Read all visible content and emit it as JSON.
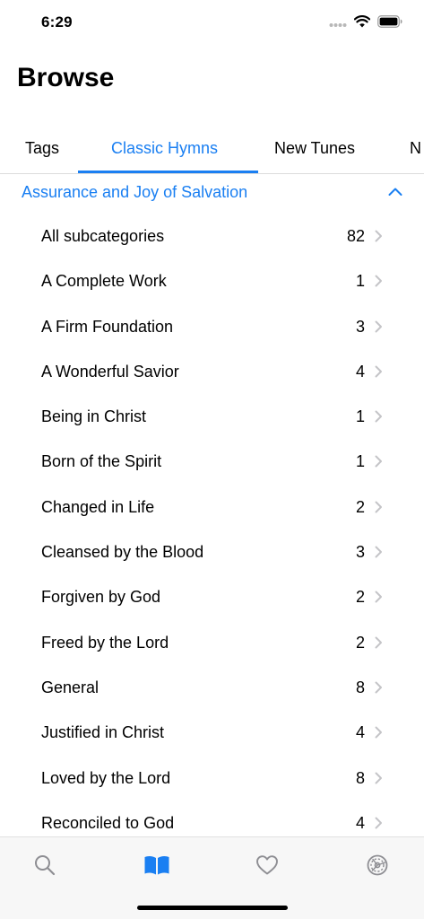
{
  "status": {
    "time": "6:29"
  },
  "header": {
    "title": "Browse"
  },
  "tabs": [
    {
      "label": "Tags"
    },
    {
      "label": "Classic Hymns"
    },
    {
      "label": "New Tunes"
    },
    {
      "label": "N"
    }
  ],
  "category": {
    "title": "Assurance and Joy of Salvation"
  },
  "rows": [
    {
      "label": "All subcategories",
      "count": "82"
    },
    {
      "label": "A Complete Work",
      "count": "1"
    },
    {
      "label": "A Firm Foundation",
      "count": "3"
    },
    {
      "label": "A Wonderful Savior",
      "count": "4"
    },
    {
      "label": "Being in Christ",
      "count": "1"
    },
    {
      "label": "Born of the Spirit",
      "count": "1"
    },
    {
      "label": "Changed in Life",
      "count": "2"
    },
    {
      "label": "Cleansed by the Blood",
      "count": "3"
    },
    {
      "label": "Forgiven by God",
      "count": "2"
    },
    {
      "label": "Freed by the Lord",
      "count": "2"
    },
    {
      "label": "General",
      "count": "8"
    },
    {
      "label": "Justified in Christ",
      "count": "4"
    },
    {
      "label": "Loved by the Lord",
      "count": "8"
    },
    {
      "label": "Reconciled to God",
      "count": "4"
    }
  ],
  "tab_bar": {
    "items": [
      {
        "icon": "search-icon"
      },
      {
        "icon": "book-icon"
      },
      {
        "icon": "heart-icon"
      },
      {
        "icon": "settings-icon"
      }
    ],
    "active_color": "#1a7ff2",
    "inactive_color": "#8e8e93"
  },
  "colors": {
    "accent": "#1a7ff2",
    "chevron": "#c4c4c7"
  }
}
